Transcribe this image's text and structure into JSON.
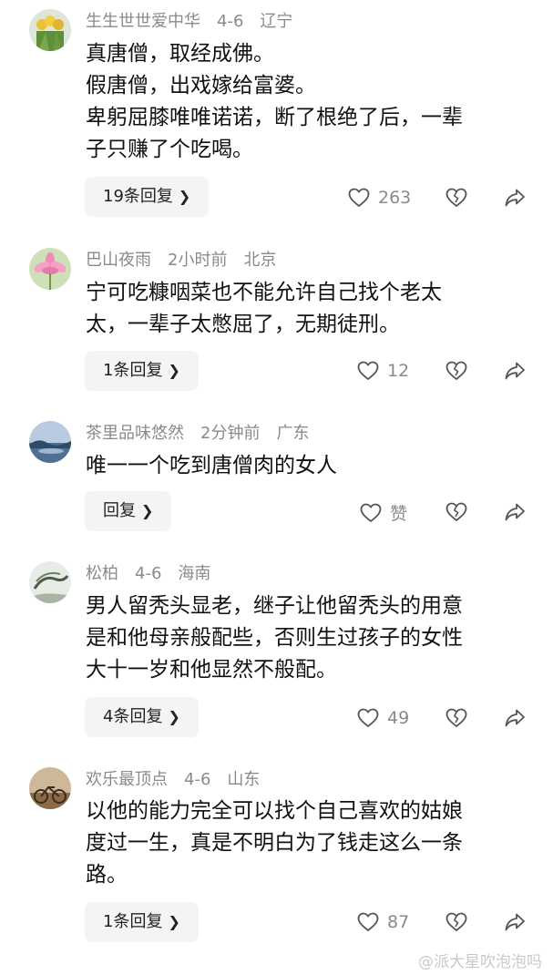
{
  "comments": [
    {
      "username": "生生世世爱中华",
      "time": "4-6",
      "location": "辽宁",
      "lines": [
        "真唐僧，取经成佛。",
        "假唐僧，出戏嫁给富婆。",
        "卑躬屈膝唯唯诺诺，断了根绝了后，一辈",
        "子只赚了个吃喝。"
      ],
      "reply_label": "19条回复",
      "likes": "263"
    },
    {
      "username": "巴山夜雨",
      "time": "2小时前",
      "location": "北京",
      "lines": [
        "宁可吃糠咽菜也不能允许自己找个老太",
        "太，一辈子太憋屈了，无期徒刑。"
      ],
      "reply_label": "1条回复",
      "likes": "12"
    },
    {
      "username": "茶里品味悠然",
      "time": "2分钟前",
      "location": "广东",
      "lines": [
        "唯一一个吃到唐僧肉的女人"
      ],
      "reply_label": "回复",
      "likes": "赞"
    },
    {
      "username": "松柏",
      "time": "4-6",
      "location": "海南",
      "lines": [
        "男人留秃头显老，继子让他留秃头的用意",
        "是和他母亲般配些，否则生过孩子的女性",
        "大十一岁和他显然不般配。"
      ],
      "reply_label": "4条回复",
      "likes": "49"
    },
    {
      "username": "欢乐最顶点",
      "time": "4-6",
      "location": "山东",
      "lines": [
        "以他的能力完全可以找个自己喜欢的姑娘",
        "度过一生，真是不明白为了钱走这么一条",
        "路。"
      ],
      "reply_label": "1条回复",
      "likes": "87"
    }
  ],
  "watermark": "@派大星吹泡泡吗",
  "icons": [
    "heart-icon",
    "broken-heart-icon",
    "share-icon",
    "chevron-right-icon"
  ]
}
